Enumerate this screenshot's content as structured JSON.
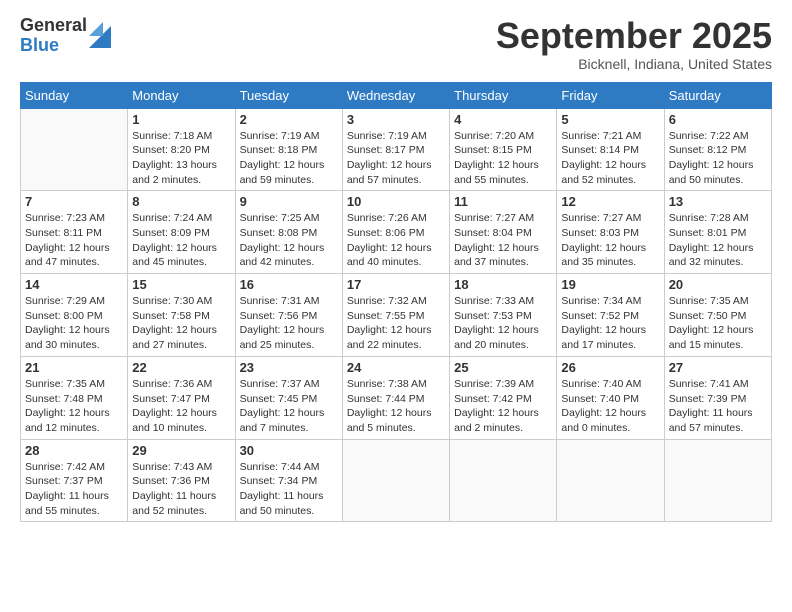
{
  "logo": {
    "general": "General",
    "blue": "Blue"
  },
  "header": {
    "month": "September 2025",
    "location": "Bicknell, Indiana, United States"
  },
  "weekdays": [
    "Sunday",
    "Monday",
    "Tuesday",
    "Wednesday",
    "Thursday",
    "Friday",
    "Saturday"
  ],
  "weeks": [
    [
      {
        "day": "",
        "info": ""
      },
      {
        "day": "1",
        "info": "Sunrise: 7:18 AM\nSunset: 8:20 PM\nDaylight: 13 hours\nand 2 minutes."
      },
      {
        "day": "2",
        "info": "Sunrise: 7:19 AM\nSunset: 8:18 PM\nDaylight: 12 hours\nand 59 minutes."
      },
      {
        "day": "3",
        "info": "Sunrise: 7:19 AM\nSunset: 8:17 PM\nDaylight: 12 hours\nand 57 minutes."
      },
      {
        "day": "4",
        "info": "Sunrise: 7:20 AM\nSunset: 8:15 PM\nDaylight: 12 hours\nand 55 minutes."
      },
      {
        "day": "5",
        "info": "Sunrise: 7:21 AM\nSunset: 8:14 PM\nDaylight: 12 hours\nand 52 minutes."
      },
      {
        "day": "6",
        "info": "Sunrise: 7:22 AM\nSunset: 8:12 PM\nDaylight: 12 hours\nand 50 minutes."
      }
    ],
    [
      {
        "day": "7",
        "info": "Sunrise: 7:23 AM\nSunset: 8:11 PM\nDaylight: 12 hours\nand 47 minutes."
      },
      {
        "day": "8",
        "info": "Sunrise: 7:24 AM\nSunset: 8:09 PM\nDaylight: 12 hours\nand 45 minutes."
      },
      {
        "day": "9",
        "info": "Sunrise: 7:25 AM\nSunset: 8:08 PM\nDaylight: 12 hours\nand 42 minutes."
      },
      {
        "day": "10",
        "info": "Sunrise: 7:26 AM\nSunset: 8:06 PM\nDaylight: 12 hours\nand 40 minutes."
      },
      {
        "day": "11",
        "info": "Sunrise: 7:27 AM\nSunset: 8:04 PM\nDaylight: 12 hours\nand 37 minutes."
      },
      {
        "day": "12",
        "info": "Sunrise: 7:27 AM\nSunset: 8:03 PM\nDaylight: 12 hours\nand 35 minutes."
      },
      {
        "day": "13",
        "info": "Sunrise: 7:28 AM\nSunset: 8:01 PM\nDaylight: 12 hours\nand 32 minutes."
      }
    ],
    [
      {
        "day": "14",
        "info": "Sunrise: 7:29 AM\nSunset: 8:00 PM\nDaylight: 12 hours\nand 30 minutes."
      },
      {
        "day": "15",
        "info": "Sunrise: 7:30 AM\nSunset: 7:58 PM\nDaylight: 12 hours\nand 27 minutes."
      },
      {
        "day": "16",
        "info": "Sunrise: 7:31 AM\nSunset: 7:56 PM\nDaylight: 12 hours\nand 25 minutes."
      },
      {
        "day": "17",
        "info": "Sunrise: 7:32 AM\nSunset: 7:55 PM\nDaylight: 12 hours\nand 22 minutes."
      },
      {
        "day": "18",
        "info": "Sunrise: 7:33 AM\nSunset: 7:53 PM\nDaylight: 12 hours\nand 20 minutes."
      },
      {
        "day": "19",
        "info": "Sunrise: 7:34 AM\nSunset: 7:52 PM\nDaylight: 12 hours\nand 17 minutes."
      },
      {
        "day": "20",
        "info": "Sunrise: 7:35 AM\nSunset: 7:50 PM\nDaylight: 12 hours\nand 15 minutes."
      }
    ],
    [
      {
        "day": "21",
        "info": "Sunrise: 7:35 AM\nSunset: 7:48 PM\nDaylight: 12 hours\nand 12 minutes."
      },
      {
        "day": "22",
        "info": "Sunrise: 7:36 AM\nSunset: 7:47 PM\nDaylight: 12 hours\nand 10 minutes."
      },
      {
        "day": "23",
        "info": "Sunrise: 7:37 AM\nSunset: 7:45 PM\nDaylight: 12 hours\nand 7 minutes."
      },
      {
        "day": "24",
        "info": "Sunrise: 7:38 AM\nSunset: 7:44 PM\nDaylight: 12 hours\nand 5 minutes."
      },
      {
        "day": "25",
        "info": "Sunrise: 7:39 AM\nSunset: 7:42 PM\nDaylight: 12 hours\nand 2 minutes."
      },
      {
        "day": "26",
        "info": "Sunrise: 7:40 AM\nSunset: 7:40 PM\nDaylight: 12 hours\nand 0 minutes."
      },
      {
        "day": "27",
        "info": "Sunrise: 7:41 AM\nSunset: 7:39 PM\nDaylight: 11 hours\nand 57 minutes."
      }
    ],
    [
      {
        "day": "28",
        "info": "Sunrise: 7:42 AM\nSunset: 7:37 PM\nDaylight: 11 hours\nand 55 minutes."
      },
      {
        "day": "29",
        "info": "Sunrise: 7:43 AM\nSunset: 7:36 PM\nDaylight: 11 hours\nand 52 minutes."
      },
      {
        "day": "30",
        "info": "Sunrise: 7:44 AM\nSunset: 7:34 PM\nDaylight: 11 hours\nand 50 minutes."
      },
      {
        "day": "",
        "info": ""
      },
      {
        "day": "",
        "info": ""
      },
      {
        "day": "",
        "info": ""
      },
      {
        "day": "",
        "info": ""
      }
    ]
  ]
}
